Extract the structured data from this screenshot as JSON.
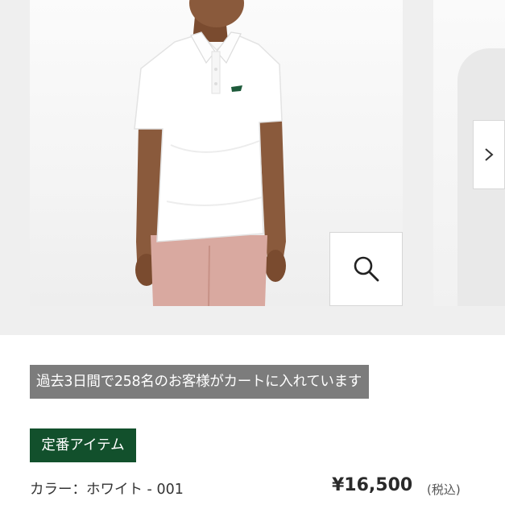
{
  "gallery": {
    "main_image_alt": "white polo shirt model",
    "zoom_icon": "magnifier-icon",
    "next_icon": "chevron-right-icon"
  },
  "product": {
    "cart_notice": "過去3日間で258名のお客様がカートに入れています",
    "badge": "定番アイテム",
    "color_label": "カラー：ホワイト - 001",
    "price": "¥16,500",
    "tax_note": "(税込)"
  },
  "colors": {
    "badge_bg": "#12502c",
    "notice_bg": "#7c7c7c",
    "shirt": "#ffffff",
    "pants": "#d9a9a0",
    "skin": "#8a5a3c"
  }
}
